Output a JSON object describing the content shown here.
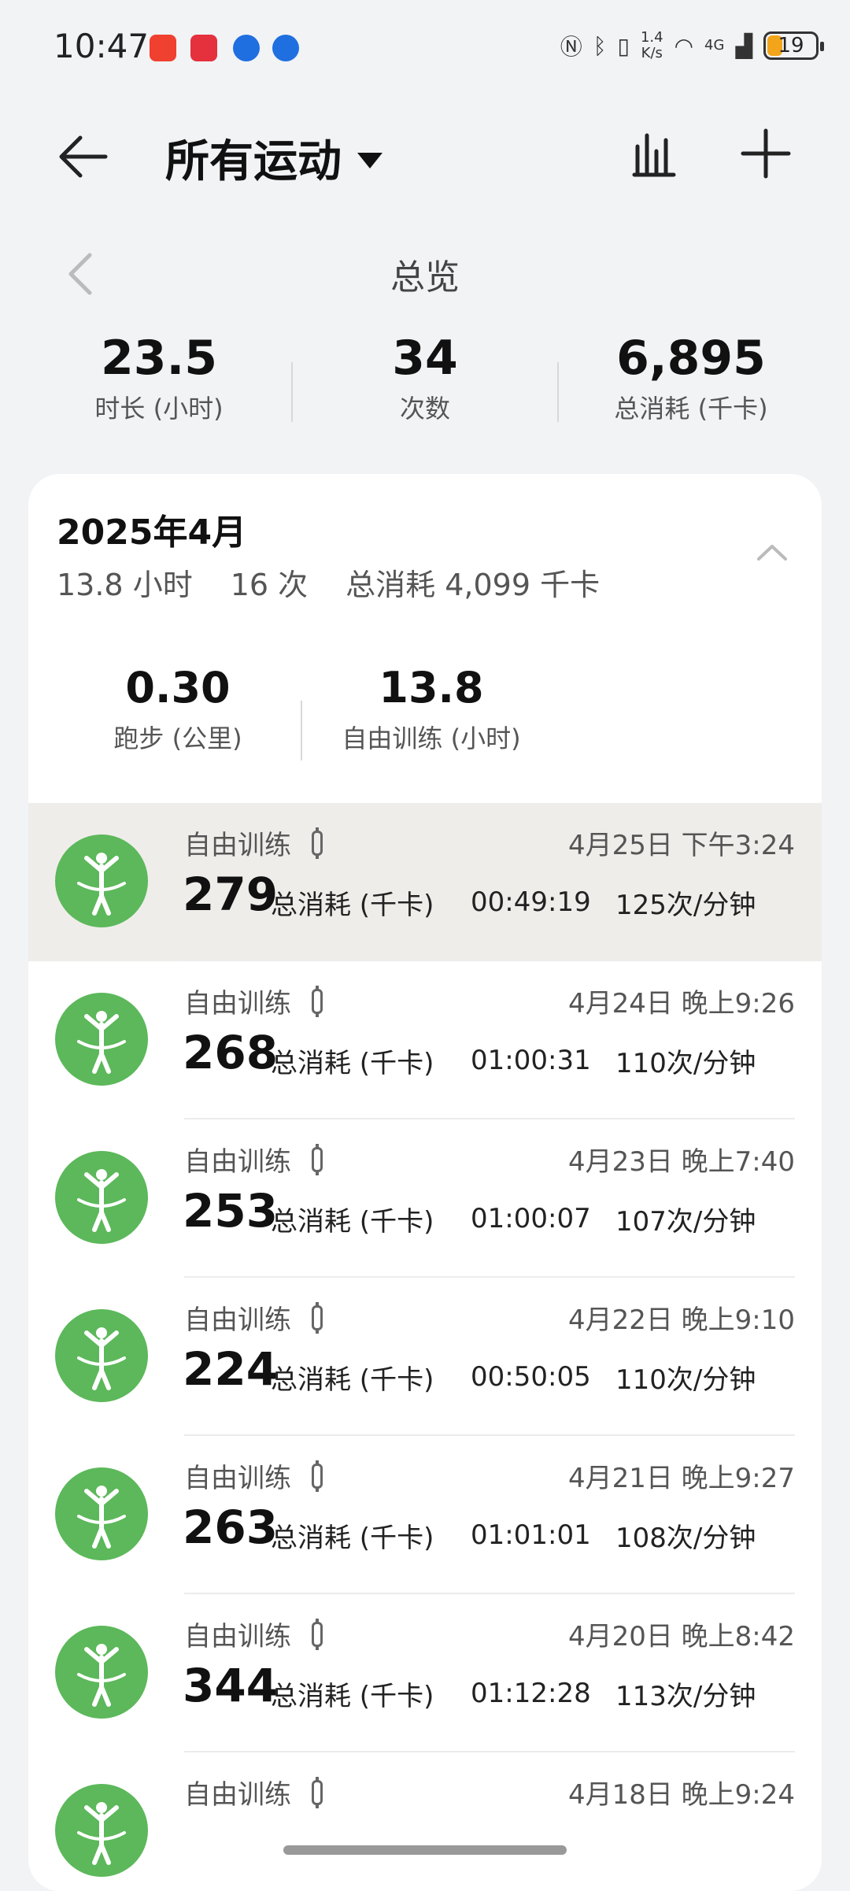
{
  "status_bar": {
    "time": "10:47",
    "speed_top": "1.4",
    "speed_bottom": "K/s",
    "network": "4G",
    "battery": "19",
    "colors": {
      "battery_fill": "#f2a51a"
    }
  },
  "header": {
    "title": "所有运动",
    "icons": [
      "back-arrow-icon",
      "dropdown-caret-icon",
      "bar-chart-icon",
      "plus-icon"
    ]
  },
  "overview": {
    "label": "总览",
    "stats": [
      {
        "value": "23.5",
        "label": "时长 (小时)"
      },
      {
        "value": "34",
        "label": "次数"
      },
      {
        "value": "6,895",
        "label": "总消耗 (千卡)"
      }
    ]
  },
  "month": {
    "title": "2025年4月",
    "hours": "13.8 小时",
    "count": "16 次",
    "total": "总消耗 4,099 千卡",
    "types": [
      {
        "value": "0.30",
        "label": "跑步 (公里)"
      },
      {
        "value": "13.8",
        "label": "自由训练 (小时)"
      }
    ]
  },
  "activities": [
    {
      "name": "自由训练",
      "time": "4月25日 下午3:24",
      "kcal": "279",
      "kcal_label": "总消耗 (千卡)",
      "duration": "00:49:19",
      "rate": "125次/分钟",
      "highlighted": true
    },
    {
      "name": "自由训练",
      "time": "4月24日 晚上9:26",
      "kcal": "268",
      "kcal_label": "总消耗 (千卡)",
      "duration": "01:00:31",
      "rate": "110次/分钟"
    },
    {
      "name": "自由训练",
      "time": "4月23日 晚上7:40",
      "kcal": "253",
      "kcal_label": "总消耗 (千卡)",
      "duration": "01:00:07",
      "rate": "107次/分钟"
    },
    {
      "name": "自由训练",
      "time": "4月22日 晚上9:10",
      "kcal": "224",
      "kcal_label": "总消耗 (千卡)",
      "duration": "00:50:05",
      "rate": "110次/分钟"
    },
    {
      "name": "自由训练",
      "time": "4月21日 晚上9:27",
      "kcal": "263",
      "kcal_label": "总消耗 (千卡)",
      "duration": "01:01:01",
      "rate": "108次/分钟"
    },
    {
      "name": "自由训练",
      "time": "4月20日 晚上8:42",
      "kcal": "344",
      "kcal_label": "总消耗 (千卡)",
      "duration": "01:12:28",
      "rate": "113次/分钟"
    },
    {
      "name": "自由训练",
      "time": "4月18日 晚上9:24",
      "kcal": "",
      "kcal_label": "",
      "duration": "",
      "rate": ""
    }
  ],
  "colors": {
    "accent_green": "#5cb85a",
    "highlight_row": "#efedea"
  }
}
